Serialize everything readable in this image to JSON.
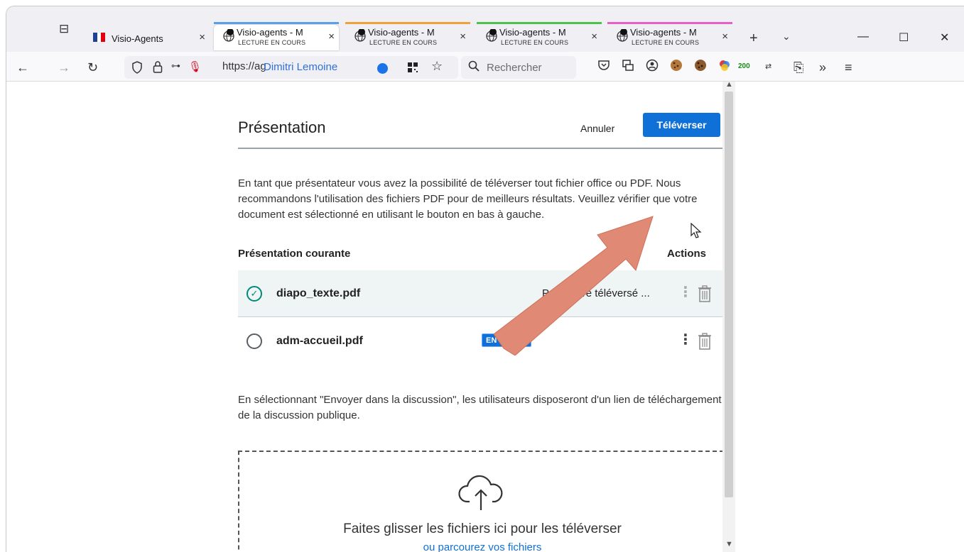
{
  "browser": {
    "tabs": [
      {
        "title": "Visio-Agents",
        "close": "×",
        "accent": "#f0f0f4"
      },
      {
        "title": "Visio-agents - M",
        "subtitle": "LECTURE EN COURS",
        "close": "×",
        "accent": "#5aa0e6"
      },
      {
        "title": "Visio-agents - M",
        "subtitle": "LECTURE EN COURS",
        "close": "×",
        "accent": "#f0a13a"
      },
      {
        "title": "Visio-agents - M",
        "subtitle": "LECTURE EN COURS",
        "close": "×",
        "accent": "#4cc24a"
      },
      {
        "title": "Visio-agents - M",
        "subtitle": "LECTURE EN COURS",
        "close": "×",
        "accent": "#e85fc8"
      }
    ],
    "new_tab": "+",
    "list_all_tabs": "⌄",
    "window_controls": {
      "minimize": "—",
      "maximize": "☐",
      "close": "✕"
    },
    "url": "https://ag",
    "url_user": "Dimitri Lemoine",
    "search_placeholder": "Rechercher",
    "ext_counter": "200",
    "overflow": "»",
    "menu": "≡"
  },
  "dialog": {
    "title": "Présentation",
    "cancel_label": "Annuler",
    "upload_label": "Téléverser",
    "intro": "En tant que présentateur vous avez la possibilité de téléverser tout fichier office ou PDF. Nous recommandons l'utilisation des fichiers PDF pour de meilleurs résultats. Veuillez vérifier que votre document est sélectionné en utilisant le bouton en bas à gauche.",
    "col_current": "Présentation courante",
    "col_actions": "Actions",
    "files": [
      {
        "name": "diapo_texte.pdf",
        "status": "Prêt à être téléversé ...",
        "selected": true
      },
      {
        "name": "adm-accueil.pdf",
        "badge": "EN COURS",
        "selected": false
      }
    ],
    "note": "En sélectionnant \"Envoyer dans la discussion\", les utilisateurs disposeront d'un lien de téléchargement de la discussion publique.",
    "drop_text": "Faites glisser les fichiers ici pour les téléverser",
    "browse_link": "ou parcourez vos fichiers"
  },
  "colors": {
    "primary": "#0f70d7",
    "selected_row": "#eef5f4",
    "check": "#008a7a",
    "annotation_arrow": "#e08a75"
  },
  "icons": [
    "tab-list-icon",
    "globe-media-icon",
    "back-icon",
    "forward-icon",
    "reload-icon",
    "shield-icon",
    "lock-icon",
    "permissions-icon",
    "microphone-icon",
    "qr-icon",
    "star-icon",
    "search-icon",
    "pocket-icon",
    "extension-icon",
    "account-icon",
    "cookie-icon",
    "color-icon",
    "converter-icon",
    "share-icon",
    "check-circle-icon",
    "radio-icon",
    "kebab-icon",
    "trash-icon",
    "upload-cloud-icon"
  ]
}
